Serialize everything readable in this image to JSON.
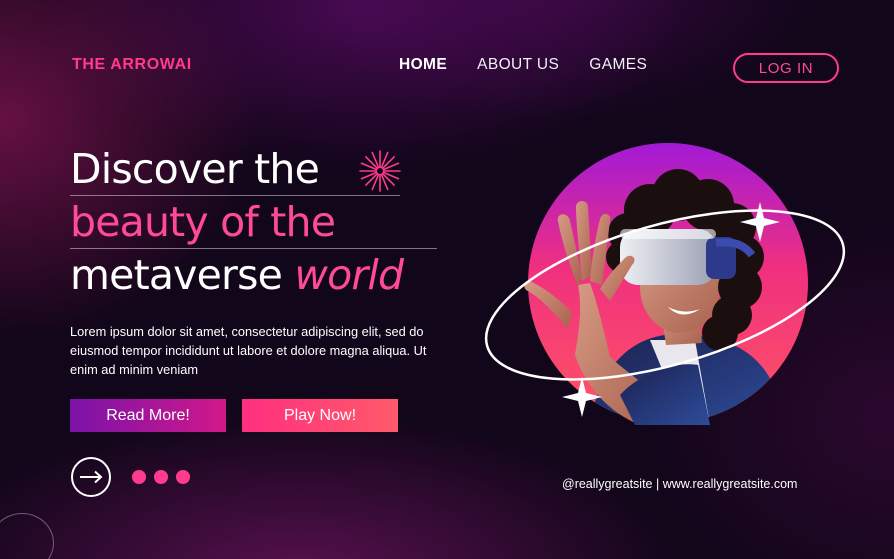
{
  "brand": "THE ARROWAI",
  "nav": {
    "items": [
      {
        "label": "HOME",
        "active": true
      },
      {
        "label": "ABOUT US",
        "active": false
      },
      {
        "label": "GAMES",
        "active": false
      }
    ],
    "login_label": "LOG IN"
  },
  "hero": {
    "line1": "Discover the",
    "line2": "beauty of the",
    "line3_a": "metaverse",
    "line3_b": "world",
    "body": "Lorem ipsum dolor sit amet, consectetur adipiscing elit, sed do eiusmod tempor incididunt ut labore et dolore magna aliqua. Ut enim ad minim veniam"
  },
  "buttons": {
    "read_more": "Read More!",
    "play_now": "Play Now!"
  },
  "footer": {
    "contact": "@reallygreatsite | www.reallygreatsite.com"
  },
  "icons": {
    "arrow": "arrow-right-circle-icon",
    "burst": "starburst-icon",
    "sparkle": "sparkle-icon"
  },
  "colors": {
    "accent": "#ff3b8d",
    "background": "#12061a",
    "read_more_gradient": [
      "#7a12a8",
      "#d2188a"
    ],
    "play_now_gradient": [
      "#ff2f7e",
      "#ff5a6a"
    ]
  }
}
